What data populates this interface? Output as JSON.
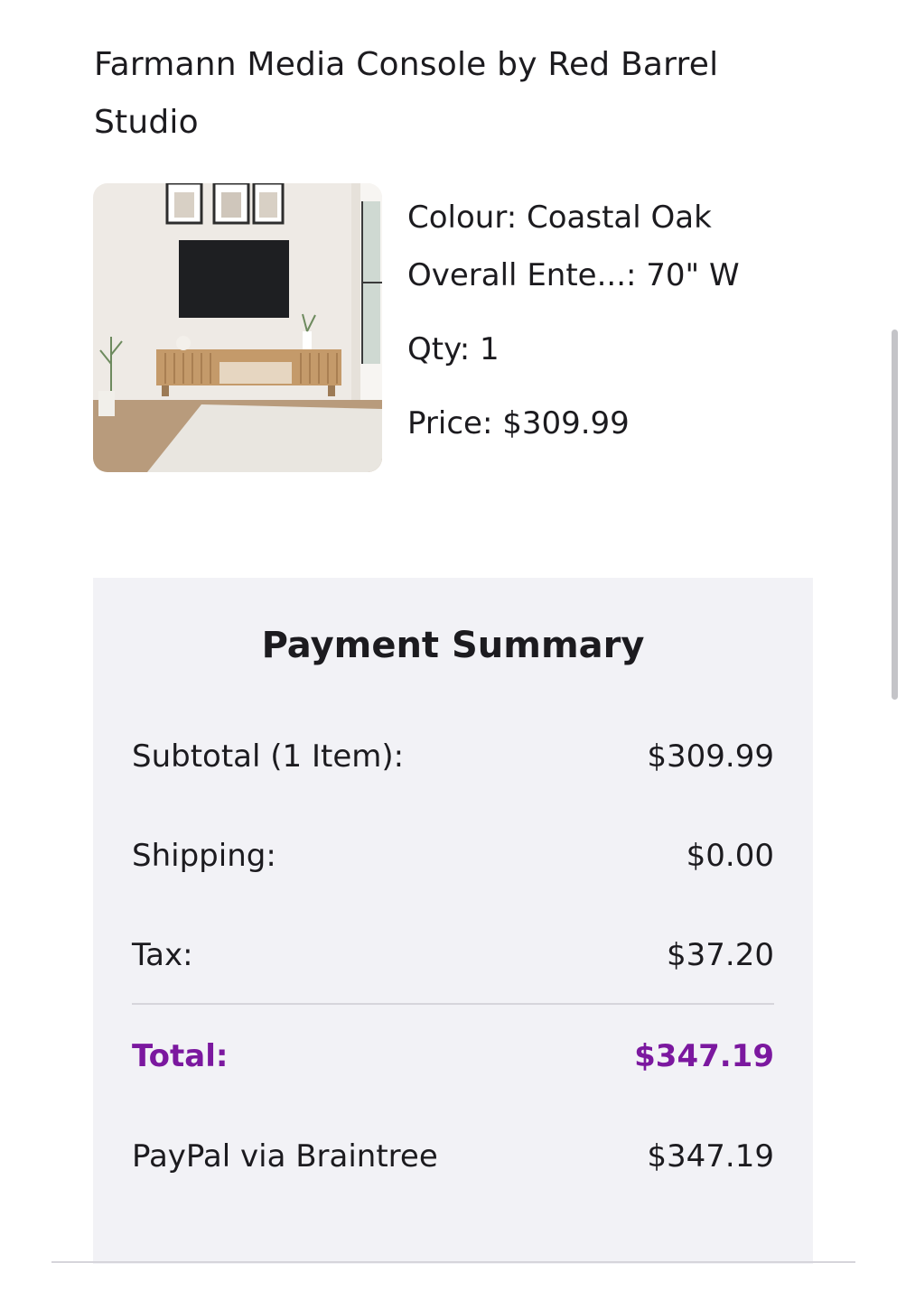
{
  "product": {
    "title": "Farmann Media Console by Red Barrel Studio",
    "image_alt": "Farmann Media Console",
    "colour": "Colour: Coastal Oak",
    "overall": "Overall Ente...: 70\" W",
    "qty": "Qty: 1",
    "price": "Price: $309.99"
  },
  "summary": {
    "title": "Payment Summary",
    "rows": [
      {
        "label": "Subtotal (1 Item):",
        "value": "$309.99"
      },
      {
        "label": "Shipping:",
        "value": "$0.00"
      },
      {
        "label": "Tax:",
        "value": "$37.20"
      },
      {
        "label": "Total:",
        "value": "$347.19"
      },
      {
        "label": "PayPal via Braintree",
        "value": "$347.19"
      }
    ]
  },
  "colors": {
    "accent": "#7b189f",
    "panel": "#f2f2f6",
    "text": "#1c1b1f"
  }
}
